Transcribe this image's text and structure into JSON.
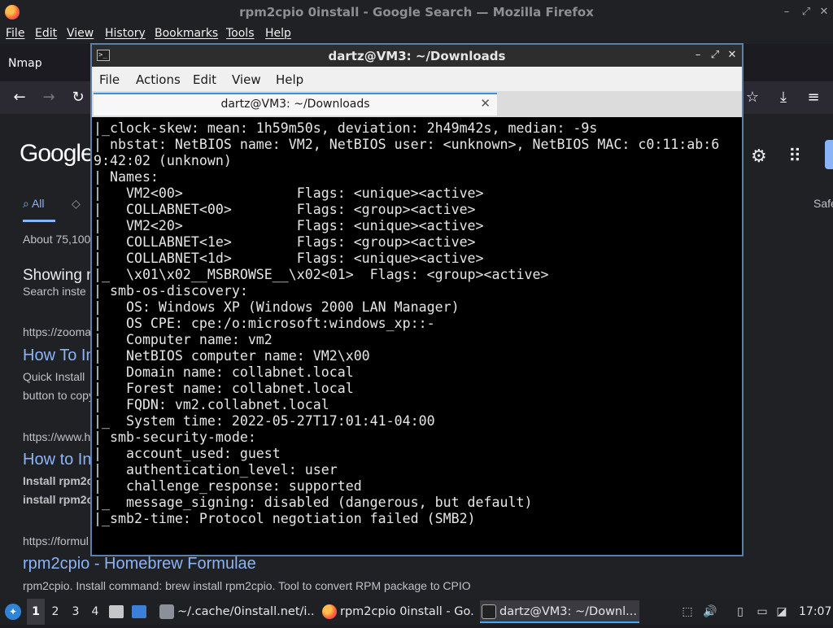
{
  "firefox": {
    "window_title": "rpm2cpio 0install - Google Search — Mozilla Firefox",
    "menu": [
      "File",
      "Edit",
      "View",
      "History",
      "Bookmarks",
      "Tools",
      "Help"
    ],
    "tab_label": "Nmap",
    "page": {
      "logo": "Google",
      "tab_all": "All",
      "safe_label": "Safe",
      "result_count": "About 75,100",
      "showing_heading": "Showing r",
      "search_instead": "Search inste",
      "results": [
        {
          "url": "https://zooma",
          "title": "How To In",
          "snippet_1": "Quick Install",
          "snippet_2": "button to copy"
        },
        {
          "url": "https://www.h",
          "title": "How to In",
          "snippet_1": "Install rpm2c",
          "snippet_2": "install rpm2c"
        },
        {
          "url": "https://formul",
          "title": "rpm2cpio - Homebrew Formulae",
          "snippet_1": "rpm2cpio. Install command: brew install rpm2cpio. Tool to convert RPM package to CPIO",
          "snippet_2": ""
        }
      ]
    }
  },
  "terminal": {
    "window_title": "dartz@VM3: ~/Downloads",
    "menu": [
      "File",
      "Actions",
      "Edit",
      "View",
      "Help"
    ],
    "tab_title": "dartz@VM3: ~/Downloads",
    "lines": [
      "|_clock-skew: mean: 1h59m50s, deviation: 2h49m42s, median: -9s",
      "| nbstat: NetBIOS name: VM2, NetBIOS user: <unknown>, NetBIOS MAC: c0:11:ab:6",
      "9:42:02 (unknown)",
      "| Names:",
      "|   VM2<00>              Flags: <unique><active>",
      "|   COLLABNET<00>        Flags: <group><active>",
      "|   VM2<20>              Flags: <unique><active>",
      "|   COLLABNET<1e>        Flags: <group><active>",
      "|   COLLABNET<1d>        Flags: <unique><active>",
      "|_  \\x01\\x02__MSBROWSE__\\x02<01>  Flags: <group><active>",
      "| smb-os-discovery:",
      "|   OS: Windows XP (Windows 2000 LAN Manager)",
      "|   OS CPE: cpe:/o:microsoft:windows_xp::-",
      "|   Computer name: vm2",
      "|   NetBIOS computer name: VM2\\x00",
      "|   Domain name: collabnet.local",
      "|   Forest name: collabnet.local",
      "|   FQDN: vm2.collabnet.local",
      "|_  System time: 2022-05-27T17:01:41-04:00",
      "| smb-security-mode:",
      "|   account_used: guest",
      "|   authentication_level: user",
      "|   challenge_response: supported",
      "|_  message_signing: disabled (dangerous, but default)",
      "|_smb2-time: Protocol negotiation failed (SMB2)"
    ]
  },
  "taskbar": {
    "workspaces": [
      "1",
      "2",
      "3",
      "4"
    ],
    "tasks": [
      {
        "label": "~/.cache/0install.net/i..."
      },
      {
        "label": "rpm2cpio 0install - Go..."
      },
      {
        "label": "dartz@VM3: ~/Downl..."
      }
    ],
    "clock": "17:07"
  }
}
